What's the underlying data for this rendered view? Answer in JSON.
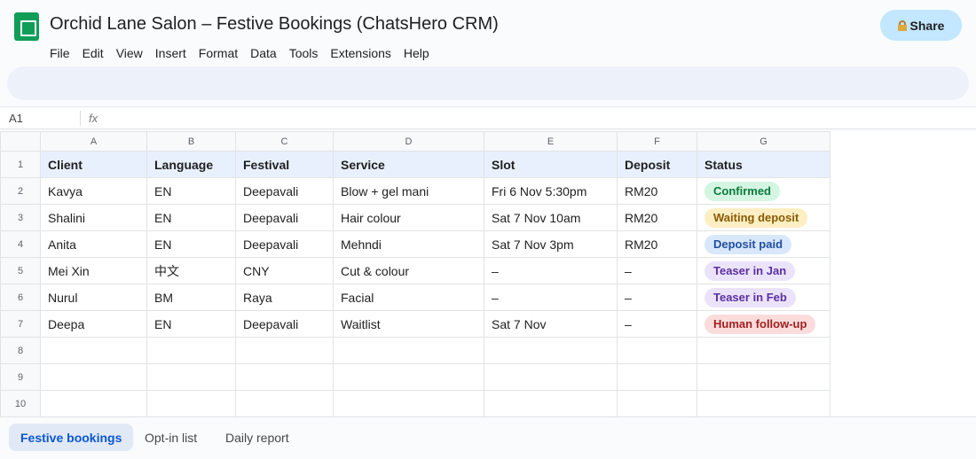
{
  "doc_title": "Orchid Lane Salon – Festive Bookings (ChatsHero CRM)",
  "share_label": "Share",
  "menu": [
    "File",
    "Edit",
    "View",
    "Insert",
    "Format",
    "Data",
    "Tools",
    "Extensions",
    "Help"
  ],
  "formula_bar": {
    "cell_ref": "A1",
    "fx": "fx"
  },
  "columns": [
    "A",
    "B",
    "C",
    "D",
    "E",
    "F",
    "G"
  ],
  "rows": [
    {
      "num": "1",
      "cells": [
        "Client",
        "Language",
        "Festival",
        "Service",
        "Slot",
        "Deposit",
        "Status"
      ]
    },
    {
      "num": "2",
      "cells": [
        "Kavya",
        "EN",
        "Deepavali",
        "Blow + gel mani",
        "Fri 6 Nov 5:30pm",
        "RM20"
      ],
      "status": {
        "label": "Confirmed",
        "bg": "#d4f5e2",
        "fg": "#0b7a3b"
      }
    },
    {
      "num": "3",
      "cells": [
        "Shalini",
        "EN",
        "Deepavali",
        "Hair colour",
        "Sat 7 Nov 10am",
        "RM20"
      ],
      "status": {
        "label": "Waiting deposit",
        "bg": "#fdefc3",
        "fg": "#8a5a00"
      }
    },
    {
      "num": "4",
      "cells": [
        "Anita",
        "EN",
        "Deepavali",
        "Mehndi",
        "Sat 7 Nov 3pm",
        "RM20"
      ],
      "status": {
        "label": "Deposit paid",
        "bg": "#d9e7fb",
        "fg": "#1f4fa0"
      }
    },
    {
      "num": "5",
      "cells": [
        "Mei Xin",
        "中文",
        "CNY",
        "Cut & colour",
        "–",
        "–"
      ],
      "status": {
        "label": "Teaser in Jan",
        "bg": "#ebe3fb",
        "fg": "#5b2fa0"
      }
    },
    {
      "num": "6",
      "cells": [
        "Nurul",
        "BM",
        "Raya",
        "Facial",
        "–",
        "–"
      ],
      "status": {
        "label": "Teaser in Feb",
        "bg": "#ebe3fb",
        "fg": "#5b2fa0"
      }
    },
    {
      "num": "7",
      "cells": [
        "Deepa",
        "EN",
        "Deepavali",
        "Waitlist",
        "Sat 7 Nov",
        "–"
      ],
      "status": {
        "label": "Human follow-up",
        "bg": "#fadcdc",
        "fg": "#a32020"
      }
    },
    {
      "num": "8",
      "cells": [
        "",
        "",
        "",
        "",
        "",
        "",
        ""
      ]
    },
    {
      "num": "9",
      "cells": [
        "",
        "",
        "",
        "",
        "",
        "",
        ""
      ]
    },
    {
      "num": "10",
      "cells": [
        "",
        "",
        "",
        "",
        "",
        "",
        ""
      ]
    }
  ],
  "sheet_tabs": [
    {
      "label": "Festive bookings",
      "active": true
    },
    {
      "label": "Opt-in list",
      "active": false
    },
    {
      "label": "Daily report",
      "active": false
    }
  ]
}
